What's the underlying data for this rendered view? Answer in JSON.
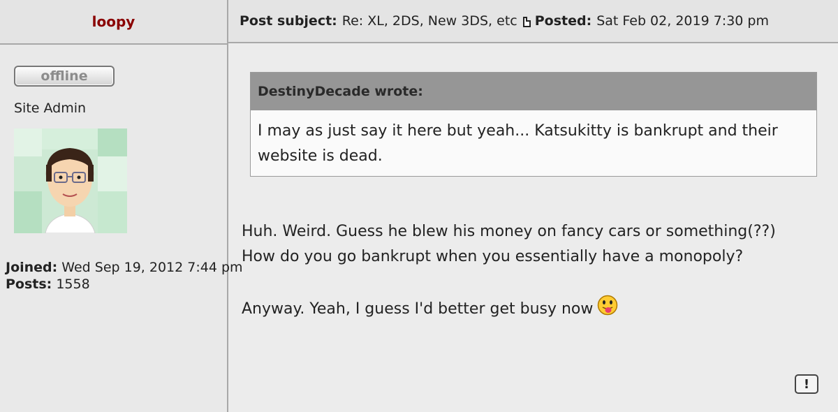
{
  "post": {
    "author": "loopy",
    "subject_label": "Post subject:",
    "subject": "Re: XL, 2DS, New 3DS, etc",
    "posted_label": "Posted:",
    "posted": "Sat Feb 02, 2019 7:30 pm"
  },
  "profile": {
    "status": "offline",
    "rank": "Site Admin",
    "joined_label": "Joined:",
    "joined": "Wed Sep 19, 2012 7:44 pm",
    "posts_label": "Posts:",
    "posts": "1558"
  },
  "quote": {
    "author": "DestinyDecade wrote:",
    "text": "I may as just say it here but yeah... Katsukitty is bankrupt and their website is dead."
  },
  "message": {
    "line1": "Huh. Weird. Guess he blew his money on fancy cars or something(??)",
    "line2": "How do you go bankrupt when you essentially have a monopoly?",
    "line3": "Anyway. Yeah, I guess I'd better get busy now"
  },
  "icons": {
    "post_icon": "page-icon",
    "smiley": "tongue-smiley-icon",
    "report": "report-icon",
    "report_glyph": "!"
  },
  "colors": {
    "username": "#8a0000",
    "quote_header": "#969696"
  }
}
